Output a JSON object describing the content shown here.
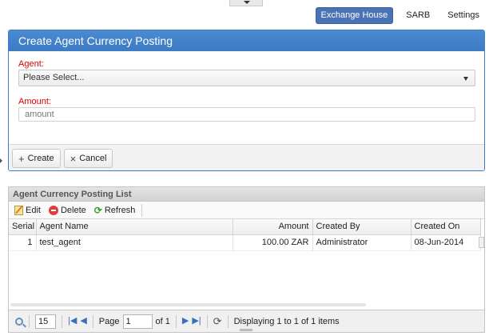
{
  "nav": {
    "items": [
      {
        "label": "Exchange House",
        "active": true
      },
      {
        "label": "SARB",
        "active": false
      },
      {
        "label": "Settings",
        "active": false
      }
    ]
  },
  "create_form": {
    "title": "Create Agent Currency Posting",
    "agent_label": "Agent:",
    "agent_value": "Please Select...",
    "amount_label": "Amount:",
    "amount_placeholder": "amount",
    "amount_value": "",
    "create_label": "Create",
    "cancel_label": "Cancel"
  },
  "list": {
    "title": "Agent Currency Posting List",
    "toolbar": {
      "edit_label": "Edit",
      "delete_label": "Delete",
      "refresh_label": "Refresh"
    },
    "columns": [
      "Serial",
      "Agent Name",
      "Amount",
      "Created By",
      "Created On"
    ],
    "rows": [
      {
        "serial": "1",
        "agent_name": "test_agent",
        "amount": "100.00 ZAR",
        "created_by": "Administrator",
        "created_on": "08-Jun-2014"
      }
    ],
    "pager": {
      "page_size": "15",
      "page_label": "Page",
      "page_value": "1",
      "of_label": "of 1",
      "display_text": "Displaying 1 to 1 of 1 items"
    }
  },
  "colors": {
    "accent": "#4a73b5",
    "panel_header": "#3d7bc4",
    "required_label": "#e10000"
  }
}
